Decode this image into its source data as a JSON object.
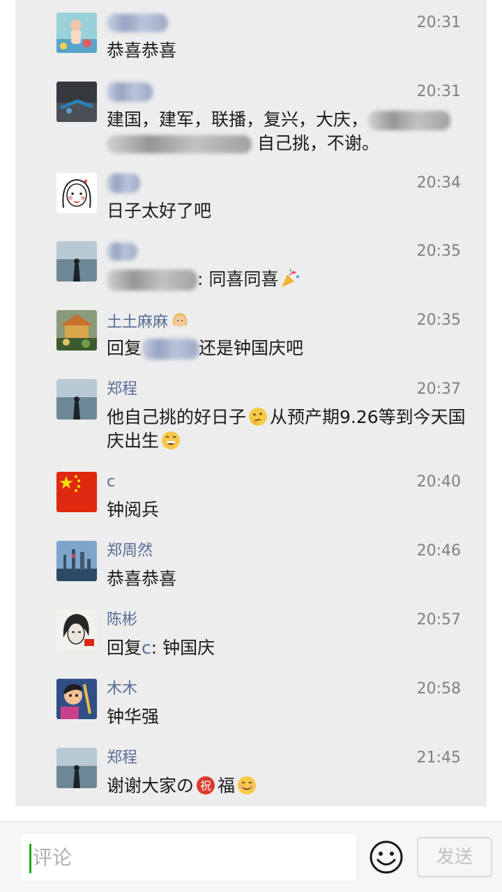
{
  "comments": [
    {
      "name": "",
      "time": "20:31",
      "text": "恭喜恭喜"
    },
    {
      "name": "",
      "time": "20:31",
      "text_part1": "建国，建军，联播，复兴，大庆，",
      "text_part2": "自己挑，不谢。"
    },
    {
      "name": "",
      "time": "20:34",
      "text": "日子太好了吧"
    },
    {
      "name": "",
      "time": "20:35",
      "text": ": 同喜同喜"
    },
    {
      "name": "土土麻麻",
      "time": "20:35",
      "text_prefix": "回复",
      "text_suffix": "还是钟国庆吧"
    },
    {
      "name": "郑程",
      "time": "20:37",
      "text_part1": "他自己挑的好日子",
      "text_part2": "从预产期9.26等到今天国庆出生"
    },
    {
      "name": "c",
      "time": "20:40",
      "text": "钟阅兵"
    },
    {
      "name": "郑周然",
      "time": "20:46",
      "text": "恭喜恭喜"
    },
    {
      "name": "陈彬",
      "time": "20:57",
      "text_prefix": "回复",
      "mention": "c",
      "text_suffix": ": 钟国庆"
    },
    {
      "name": "木木",
      "time": "20:58",
      "text": "钟华强"
    },
    {
      "name": "郑程",
      "time": "21:45",
      "text_part1": "谢谢大家の",
      "text_part2": "福"
    }
  ],
  "input": {
    "placeholder": "评论"
  },
  "send_label": "发送",
  "icons": {
    "emoji_button": "smiley-face-icon"
  },
  "colors": {
    "name": "#576b95",
    "cursor": "#1aad19",
    "time": "#808080"
  }
}
